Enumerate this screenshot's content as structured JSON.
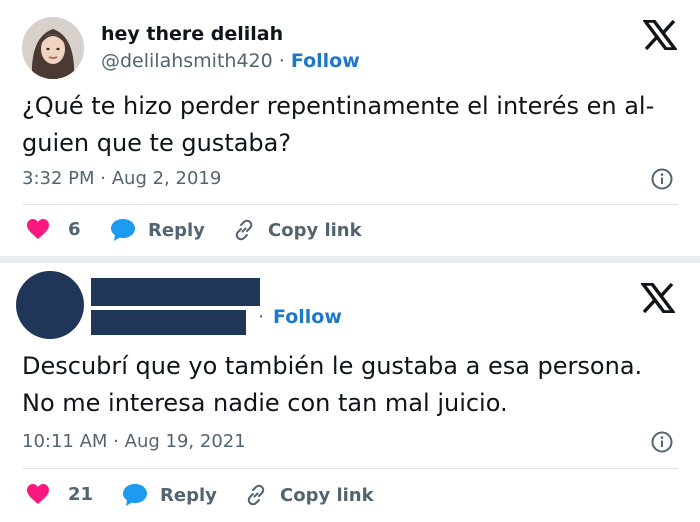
{
  "tweets": [
    {
      "display_name": "hey there delilah",
      "handle": "@delilahsmith420",
      "separator": "·",
      "follow_label": "Follow",
      "text": "¿Qué te hizo perder repentinamente el interés en al-guien que te gustaba?",
      "time": "3:32 PM",
      "date": "Aug 2, 2019",
      "likes": "6",
      "reply_label": "Reply",
      "copy_label": "Copy link"
    },
    {
      "display_name": "",
      "handle": "",
      "separator": "·",
      "follow_label": "Follow",
      "text": "Descubrí que yo también le gustaba a esa persona. No me interesa nadie con tan mal juicio.",
      "time": "10:11 AM",
      "date": "Aug 19, 2021",
      "likes": "21",
      "reply_label": "Reply",
      "copy_label": "Copy link"
    }
  ],
  "colors": {
    "heart": "#f91880",
    "reply_bubble": "#1d9bf0",
    "follow": "#1d78c9",
    "redaction": "#203659"
  },
  "icons": [
    "x-logo-icon",
    "info-icon",
    "heart-icon",
    "reply-bubble-icon",
    "link-icon"
  ]
}
